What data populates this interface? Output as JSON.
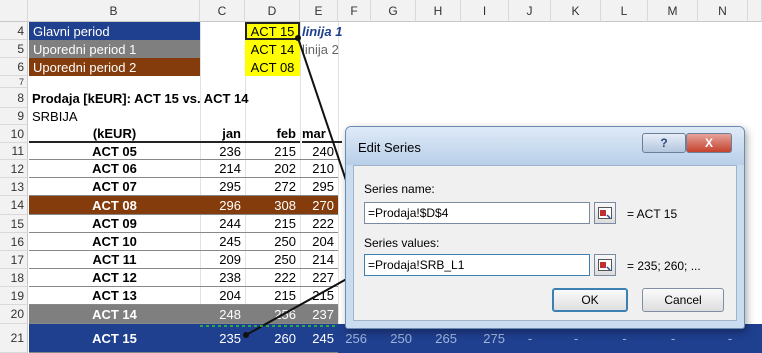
{
  "columns": [
    "B",
    "C",
    "D",
    "E",
    "F",
    "G",
    "H",
    "I",
    "J",
    "K",
    "L",
    "M",
    "N"
  ],
  "rows": [
    "4",
    "5",
    "6",
    "7",
    "8",
    "9",
    "10",
    "11",
    "12",
    "13",
    "14",
    "15",
    "16",
    "17",
    "18",
    "19",
    "20",
    "21"
  ],
  "periods": [
    {
      "label": "Glavni period",
      "value": "ACT 15",
      "line": "linija 1"
    },
    {
      "label": "Uporedni period 1",
      "value": "ACT 14",
      "line": "linija 2"
    },
    {
      "label": "Uporedni period 2",
      "value": "ACT 08",
      "line": ""
    }
  ],
  "report_title": "Prodaja [kEUR]: ACT 15 vs. ACT 14",
  "region": "SRBIJA",
  "table_header": [
    "(kEUR)",
    "jan",
    "feb",
    "mar"
  ],
  "table_rows": [
    {
      "name": "ACT 05",
      "jan": "236",
      "feb": "215",
      "mar": "240"
    },
    {
      "name": "ACT 06",
      "jan": "214",
      "feb": "202",
      "mar": "210"
    },
    {
      "name": "ACT 07",
      "jan": "295",
      "feb": "272",
      "mar": "295"
    },
    {
      "name": "ACT 08",
      "jan": "296",
      "feb": "308",
      "mar": "270"
    },
    {
      "name": "ACT 09",
      "jan": "244",
      "feb": "215",
      "mar": "222"
    },
    {
      "name": "ACT 10",
      "jan": "245",
      "feb": "250",
      "mar": "204"
    },
    {
      "name": "ACT 11",
      "jan": "209",
      "feb": "250",
      "mar": "214"
    },
    {
      "name": "ACT 12",
      "jan": "238",
      "feb": "222",
      "mar": "227"
    },
    {
      "name": "ACT 13",
      "jan": "204",
      "feb": "215",
      "mar": "215"
    },
    {
      "name": "ACT 14",
      "jan": "248",
      "feb": "256",
      "mar": "237"
    },
    {
      "name": "ACT 15",
      "jan": "235",
      "feb": "260",
      "mar": "245"
    }
  ],
  "row15_extra": [
    "256",
    "250",
    "265",
    "275",
    "-",
    "-",
    "-",
    "-",
    "-"
  ],
  "dialog": {
    "title": "Edit Series",
    "help": "?",
    "close": "X",
    "series_name_label": "Series name:",
    "series_name_value": "=Prodaja!$D$4",
    "series_name_preview": "= ACT 15",
    "series_values_label": "Series values:",
    "series_values_value": "=Prodaja!SRB_L1",
    "series_values_preview": "= 235;  260; ...",
    "ok": "OK",
    "cancel": "Cancel"
  },
  "colors": {
    "blue": "#1f3f8f",
    "gray": "#7f7f7f",
    "brown": "#843c0c",
    "yellow": "#ffff00",
    "link": "#1f4ea0"
  }
}
